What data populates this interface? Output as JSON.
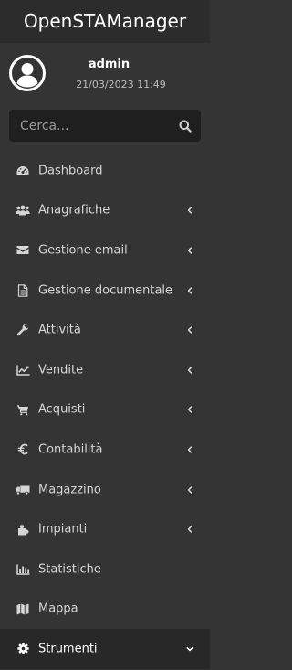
{
  "brand": {
    "title": "OpenSTAManager"
  },
  "user": {
    "name": "admin",
    "datetime": "21/03/2023 11:49"
  },
  "search": {
    "placeholder": "Cerca..."
  },
  "menu": [
    {
      "label": "Dashboard",
      "icon": "dashboard-icon",
      "has_children": false
    },
    {
      "label": "Anagrafiche",
      "icon": "users-icon",
      "has_children": true
    },
    {
      "label": "Gestione email",
      "icon": "envelope-icon",
      "has_children": true
    },
    {
      "label": "Gestione documentale",
      "icon": "file-text-icon",
      "has_children": true
    },
    {
      "label": "Attività",
      "icon": "wrench-icon",
      "has_children": true
    },
    {
      "label": "Vendite",
      "icon": "line-chart-icon",
      "has_children": true
    },
    {
      "label": "Acquisti",
      "icon": "shopping-cart-icon",
      "has_children": true
    },
    {
      "label": "Contabilità",
      "icon": "euro-icon",
      "has_children": true
    },
    {
      "label": "Magazzino",
      "icon": "truck-icon",
      "has_children": true
    },
    {
      "label": "Impianti",
      "icon": "puzzle-piece-icon",
      "has_children": true
    },
    {
      "label": "Statistiche",
      "icon": "bar-chart-icon",
      "has_children": false
    },
    {
      "label": "Mappa",
      "icon": "map-icon",
      "has_children": false
    },
    {
      "label": "Strumenti",
      "icon": "cog-icon",
      "has_children": true,
      "expanded": true,
      "active": true
    }
  ],
  "colors": {
    "sidebar_bg": "#343434",
    "brand_bg": "#2c2c2c",
    "search_bg": "#1f1f1f",
    "active_bg": "#282828",
    "text": "#d6d6d6"
  }
}
